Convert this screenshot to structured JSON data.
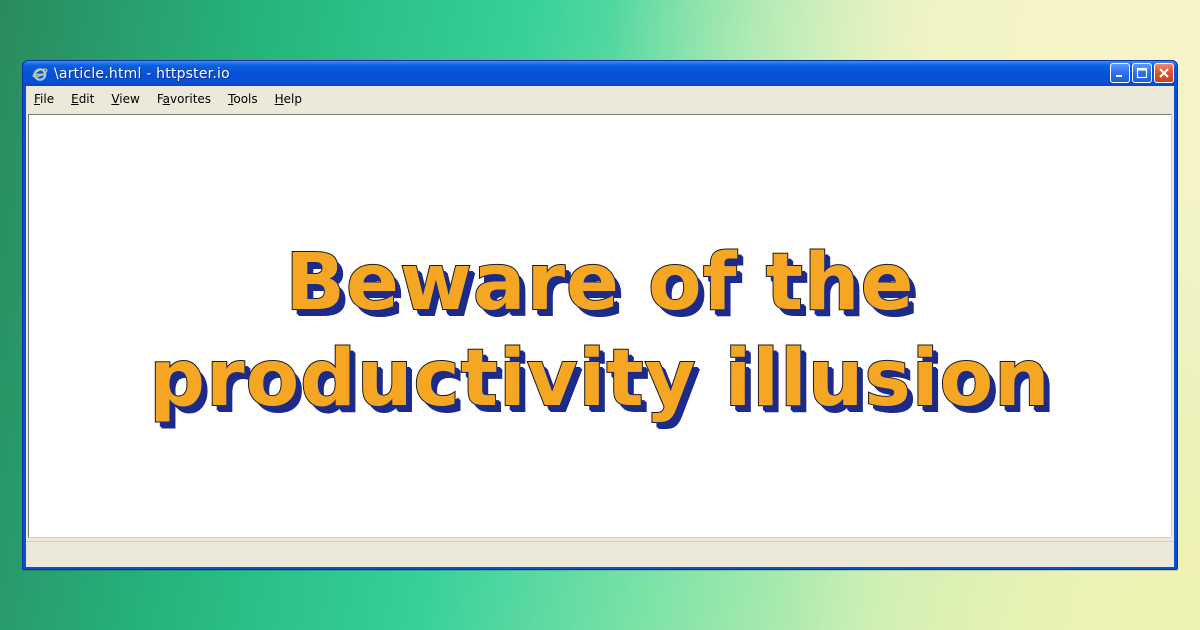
{
  "window": {
    "title": "\\article.html - httpster.io"
  },
  "menu": {
    "items": [
      {
        "key": "F",
        "rest": "ile"
      },
      {
        "key": "E",
        "rest": "dit"
      },
      {
        "key": "V",
        "rest": "iew"
      },
      {
        "key": "a",
        "pre": "F",
        "rest": "vorites"
      },
      {
        "key": "T",
        "rest": "ools"
      },
      {
        "key": "H",
        "rest": "elp"
      }
    ]
  },
  "page": {
    "headline_line1": "Beware of the",
    "headline_line2": "productivity illusion"
  },
  "icons": {
    "title": "ie-icon",
    "minimize": "minimize-icon",
    "maximize": "maximize-icon",
    "close": "close-icon"
  },
  "colors": {
    "titlebar": "#0a4fd6",
    "headline_fill": "#f5a623",
    "headline_shadow": "#1c2a8a",
    "chrome": "#ece9d8"
  }
}
